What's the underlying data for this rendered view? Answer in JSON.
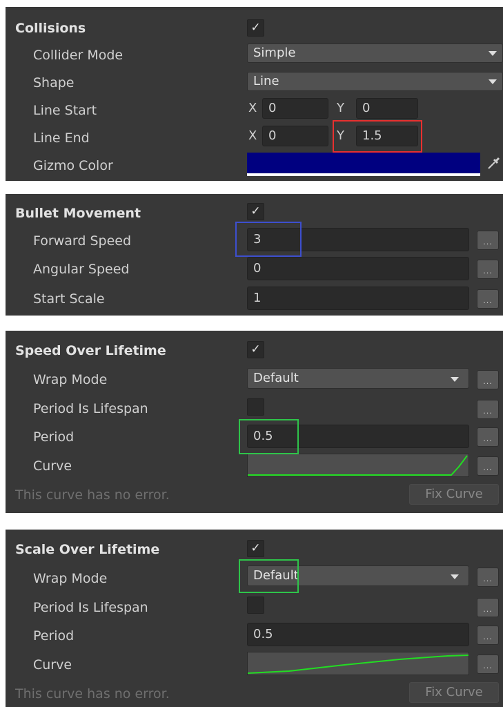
{
  "colors": {
    "panel_bg": "#383838",
    "gizmo_color": "#000080",
    "curve_color": "#22dd22",
    "highlight_red": "#e8302f",
    "highlight_blue": "#3d4fcf",
    "highlight_green": "#2ec44a"
  },
  "collisions": {
    "header": "Collisions",
    "enabled": true,
    "checkmark": "✓",
    "collider_mode": {
      "label": "Collider Mode",
      "value": "Simple"
    },
    "shape": {
      "label": "Shape",
      "value": "Line"
    },
    "line_start": {
      "label": "Line Start",
      "x_label": "X",
      "x": "0",
      "y_label": "Y",
      "y": "0"
    },
    "line_end": {
      "label": "Line End",
      "x_label": "X",
      "x": "0",
      "y_label": "Y",
      "y": "1.5"
    },
    "gizmo_color": {
      "label": "Gizmo Color",
      "picker_icon": "eyedropper-icon"
    }
  },
  "bullet_movement": {
    "header": "Bullet Movement",
    "enabled": true,
    "checkmark": "✓",
    "forward_speed": {
      "label": "Forward Speed",
      "value": "3"
    },
    "angular_speed": {
      "label": "Angular Speed",
      "value": "0"
    },
    "start_scale": {
      "label": "Start Scale",
      "value": "1"
    }
  },
  "speed_over_lifetime": {
    "header": "Speed Over Lifetime",
    "enabled": true,
    "checkmark": "✓",
    "wrap_mode": {
      "label": "Wrap Mode",
      "value": "Default"
    },
    "period_is_lifespan": {
      "label": "Period Is Lifespan",
      "checked": false
    },
    "period": {
      "label": "Period",
      "value": "0.5"
    },
    "curve": {
      "label": "Curve",
      "shape": "ease-in-late-rise"
    },
    "status": "This curve has no error.",
    "fix_button": "Fix Curve"
  },
  "scale_over_lifetime": {
    "header": "Scale Over Lifetime",
    "enabled": true,
    "checkmark": "✓",
    "wrap_mode": {
      "label": "Wrap Mode",
      "value": "Default"
    },
    "period_is_lifespan": {
      "label": "Period Is Lifespan",
      "checked": false
    },
    "period": {
      "label": "Period",
      "value": "0.5"
    },
    "curve": {
      "label": "Curve",
      "shape": "gradual-rise"
    },
    "status": "This curve has no error.",
    "fix_button": "Fix Curve"
  },
  "more_button_label": "..."
}
